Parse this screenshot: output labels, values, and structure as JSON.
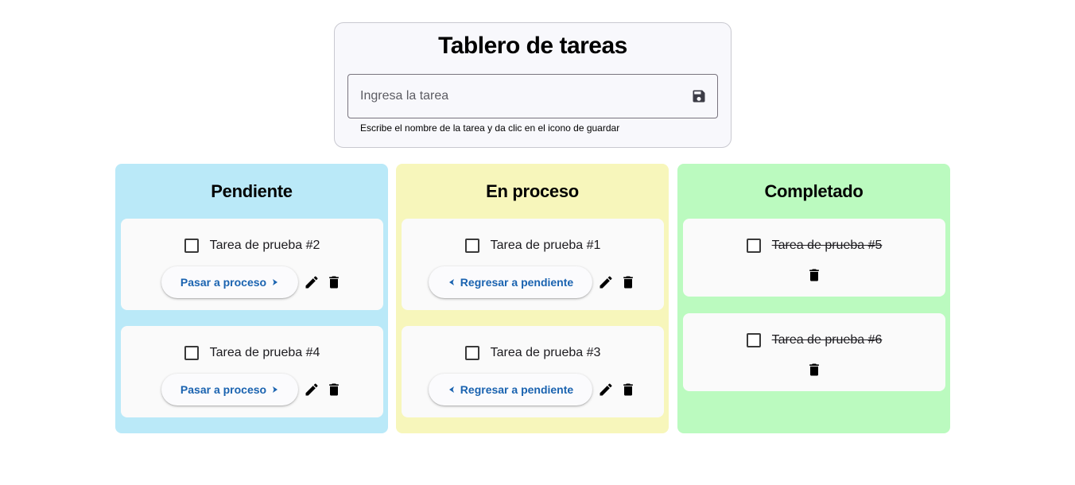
{
  "header": {
    "title": "Tablero de tareas",
    "input_placeholder": "Ingresa la tarea",
    "input_value": "",
    "helper_text": "Escribe el nombre de la tarea y da clic en el icono de guardar",
    "save_icon": "save-icon"
  },
  "columns": [
    {
      "title": "Pendiente",
      "color": "#bae9f8",
      "tasks": [
        {
          "label": "Tarea de prueba #2",
          "checked": false,
          "action_label": "Pasar a proceso",
          "action_icon": "chevron-right-icon"
        },
        {
          "label": "Tarea de prueba #4",
          "checked": false,
          "action_label": "Pasar a proceso",
          "action_icon": "chevron-right-icon"
        }
      ]
    },
    {
      "title": "En proceso",
      "color": "#f7f6bb",
      "tasks": [
        {
          "label": "Tarea de prueba #1",
          "checked": false,
          "action_label": "Regresar a pendiente",
          "action_icon": "chevron-left-icon"
        },
        {
          "label": "Tarea de prueba #3",
          "checked": false,
          "action_label": "Regresar a pendiente",
          "action_icon": "chevron-left-icon"
        }
      ]
    },
    {
      "title": "Completado",
      "color": "#bbfabf",
      "tasks": [
        {
          "label": "Tarea de prueba #5",
          "checked": false
        },
        {
          "label": "Tarea de prueba #6",
          "checked": false
        }
      ]
    }
  ],
  "colors": {
    "accent": "#1a63b0",
    "card_background": "#fafafa"
  }
}
